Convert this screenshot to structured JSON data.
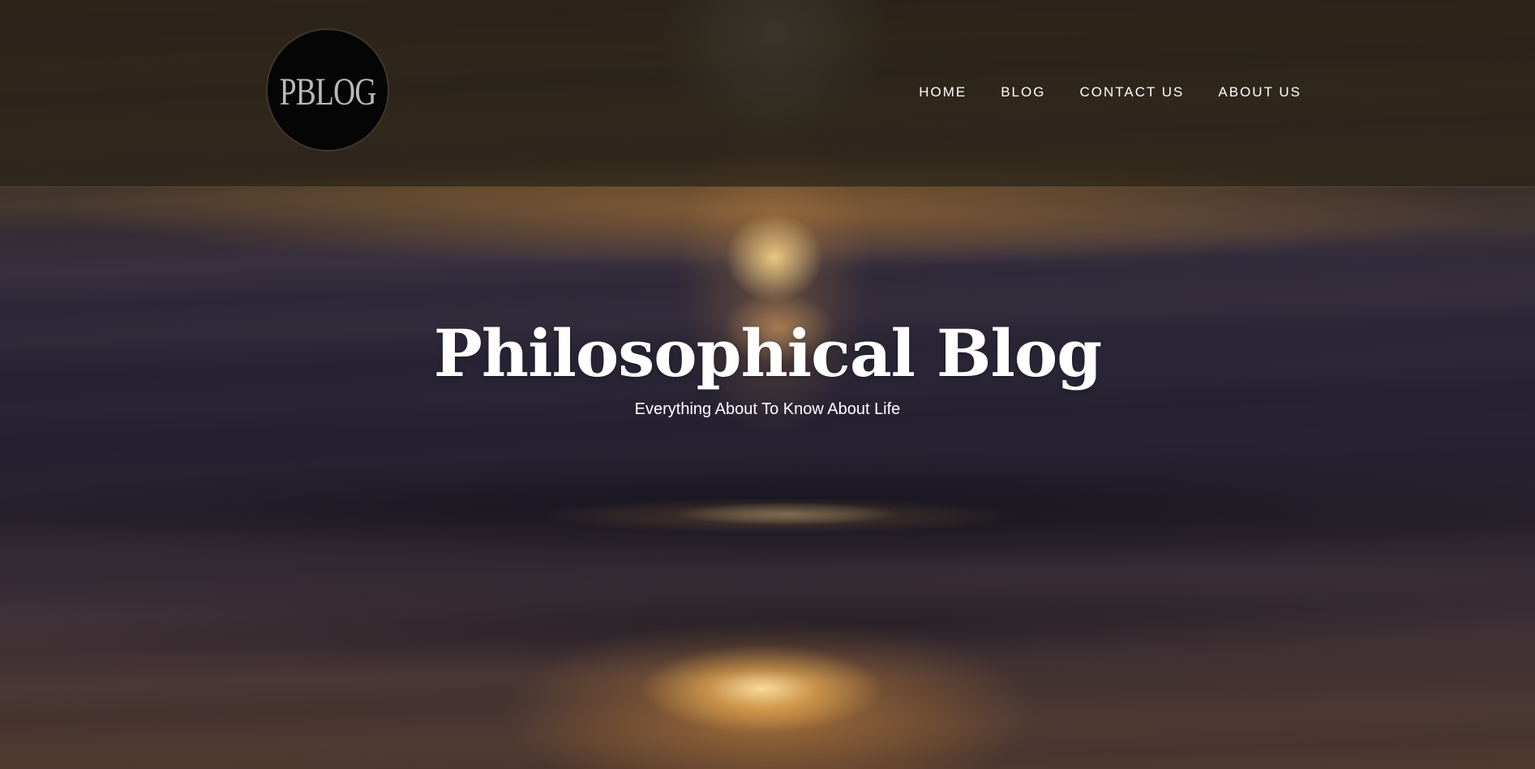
{
  "site": {
    "logo_text": "PBLOG"
  },
  "nav": {
    "items": [
      {
        "label": "HOME"
      },
      {
        "label": "BLOG"
      },
      {
        "label": "CONTACT US"
      },
      {
        "label": "ABOUT US"
      }
    ]
  },
  "hero": {
    "title": "Philosophical Blog",
    "subtitle": "Everything About To Know About Life",
    "background": "sunset-over-water"
  },
  "colors": {
    "header_overlay": "#2a2218",
    "text": "#ffffff",
    "logo_bg": "#050505",
    "logo_text": "#b9b9b9"
  }
}
